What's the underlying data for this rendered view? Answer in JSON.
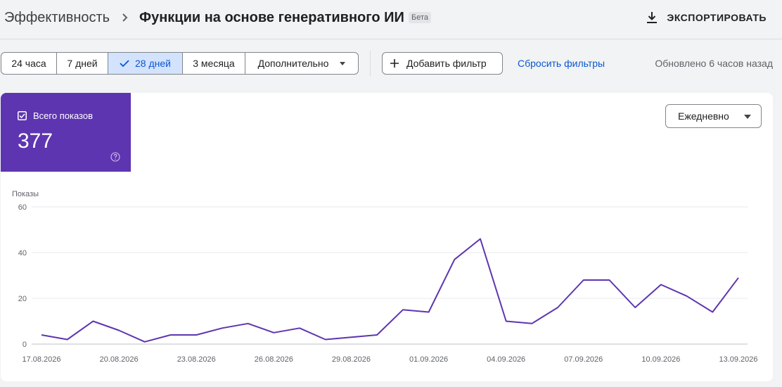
{
  "header": {
    "crumb_parent": "Эффективность",
    "crumb_current": "Функции на основе генеративного ИИ",
    "badge": "Бета",
    "export_label": "ЭКСПОРТИРОВАТЬ"
  },
  "toolbar": {
    "ranges": [
      {
        "label": "24 часа",
        "selected": false
      },
      {
        "label": "7 дней",
        "selected": false
      },
      {
        "label": "28 дней",
        "selected": true
      },
      {
        "label": "3 месяца",
        "selected": false
      }
    ],
    "more_label": "Дополнительно",
    "add_filter_label": "Добавить фильтр",
    "reset_label": "Сбросить фильтры",
    "updated_text": "Обновлено 6 часов назад"
  },
  "metric": {
    "label": "Всего показов",
    "value": "377",
    "color": "#5e35b1"
  },
  "granularity": {
    "selected": "Ежедневно"
  },
  "chart_data": {
    "type": "line",
    "ylabel": "Показы",
    "xlabel": "",
    "ylim": [
      0,
      60
    ],
    "yticks": [
      0,
      20,
      40,
      60
    ],
    "x": [
      "17.08.2026",
      "18.08.2026",
      "19.08.2026",
      "20.08.2026",
      "21.08.2026",
      "22.08.2026",
      "23.08.2026",
      "24.08.2026",
      "25.08.2026",
      "26.08.2026",
      "27.08.2026",
      "28.08.2026",
      "29.08.2026",
      "30.08.2026",
      "31.08.2026",
      "01.09.2026",
      "02.09.2026",
      "03.09.2026",
      "04.09.2026",
      "05.09.2026",
      "06.09.2026",
      "07.09.2026",
      "08.09.2026",
      "09.09.2026",
      "10.09.2026",
      "11.09.2026",
      "12.09.2026",
      "13.09.2026"
    ],
    "xtick_labels": [
      "17.08.2026",
      "20.08.2026",
      "23.08.2026",
      "26.08.2026",
      "29.08.2026",
      "01.09.2026",
      "04.09.2026",
      "07.09.2026",
      "10.09.2026",
      "13.09.2026"
    ],
    "series": [
      {
        "values": [
          4,
          2,
          10,
          6,
          1,
          4,
          4,
          7,
          9,
          5,
          7,
          2,
          3,
          4,
          15,
          14,
          37,
          46,
          10,
          9,
          16,
          28,
          28,
          16,
          26,
          21,
          14,
          29
        ],
        "color": "#5e35b1"
      }
    ],
    "grid": true,
    "legend": "none"
  }
}
